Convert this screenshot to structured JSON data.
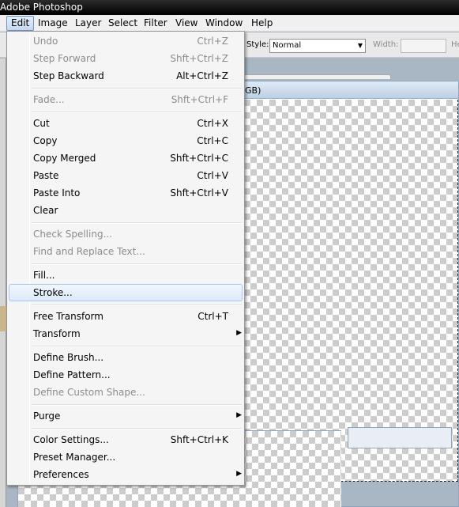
{
  "app": {
    "title": "Adobe Photoshop"
  },
  "menubar": {
    "items": [
      "Edit",
      "Image",
      "Layer",
      "Select",
      "Filter",
      "View",
      "Window",
      "Help"
    ],
    "active": "Edit"
  },
  "options": {
    "style_label": "Style:",
    "style_value": "Normal",
    "width_label": "Width:",
    "height_label_partial": "He"
  },
  "document": {
    "title_partial": "GB)"
  },
  "edit_menu": {
    "items": [
      {
        "label": "Undo",
        "shortcut": "Ctrl+Z",
        "disabled": true
      },
      {
        "label": "Step Forward",
        "shortcut": "Shft+Ctrl+Z",
        "disabled": true
      },
      {
        "label": "Step Backward",
        "shortcut": "Alt+Ctrl+Z",
        "disabled": false
      },
      {
        "label": "Fade...",
        "shortcut": "Shft+Ctrl+F",
        "disabled": true
      },
      {
        "label": "Cut",
        "shortcut": "Ctrl+X",
        "disabled": false
      },
      {
        "label": "Copy",
        "shortcut": "Ctrl+C",
        "disabled": false
      },
      {
        "label": "Copy Merged",
        "shortcut": "Shft+Ctrl+C",
        "disabled": false
      },
      {
        "label": "Paste",
        "shortcut": "Ctrl+V",
        "disabled": false
      },
      {
        "label": "Paste Into",
        "shortcut": "Shft+Ctrl+V",
        "disabled": false
      },
      {
        "label": "Clear",
        "shortcut": "",
        "disabled": false
      },
      {
        "label": "Check Spelling...",
        "shortcut": "",
        "disabled": true
      },
      {
        "label": "Find and Replace Text...",
        "shortcut": "",
        "disabled": true
      },
      {
        "label": "Fill...",
        "shortcut": "",
        "disabled": false
      },
      {
        "label": "Stroke...",
        "shortcut": "",
        "disabled": false,
        "highlighted": true
      },
      {
        "label": "Free Transform",
        "shortcut": "Ctrl+T",
        "disabled": false
      },
      {
        "label": "Transform",
        "shortcut": "",
        "disabled": false,
        "submenu": true
      },
      {
        "label": "Define Brush...",
        "shortcut": "",
        "disabled": false
      },
      {
        "label": "Define Pattern...",
        "shortcut": "",
        "disabled": false
      },
      {
        "label": "Define Custom Shape...",
        "shortcut": "",
        "disabled": true
      },
      {
        "label": "Purge",
        "shortcut": "",
        "disabled": false,
        "submenu": true
      },
      {
        "label": "Color Settings...",
        "shortcut": "Shft+Ctrl+K",
        "disabled": false
      },
      {
        "label": "Preset Manager...",
        "shortcut": "",
        "disabled": false
      },
      {
        "label": "Preferences",
        "shortcut": "",
        "disabled": false,
        "submenu": true
      }
    ],
    "submenu_arrow": "▶"
  },
  "colors": {
    "highlight_border": "#a8c8ec",
    "disabled_text": "#8c8c8c",
    "workspace": "#a9b6c4"
  }
}
